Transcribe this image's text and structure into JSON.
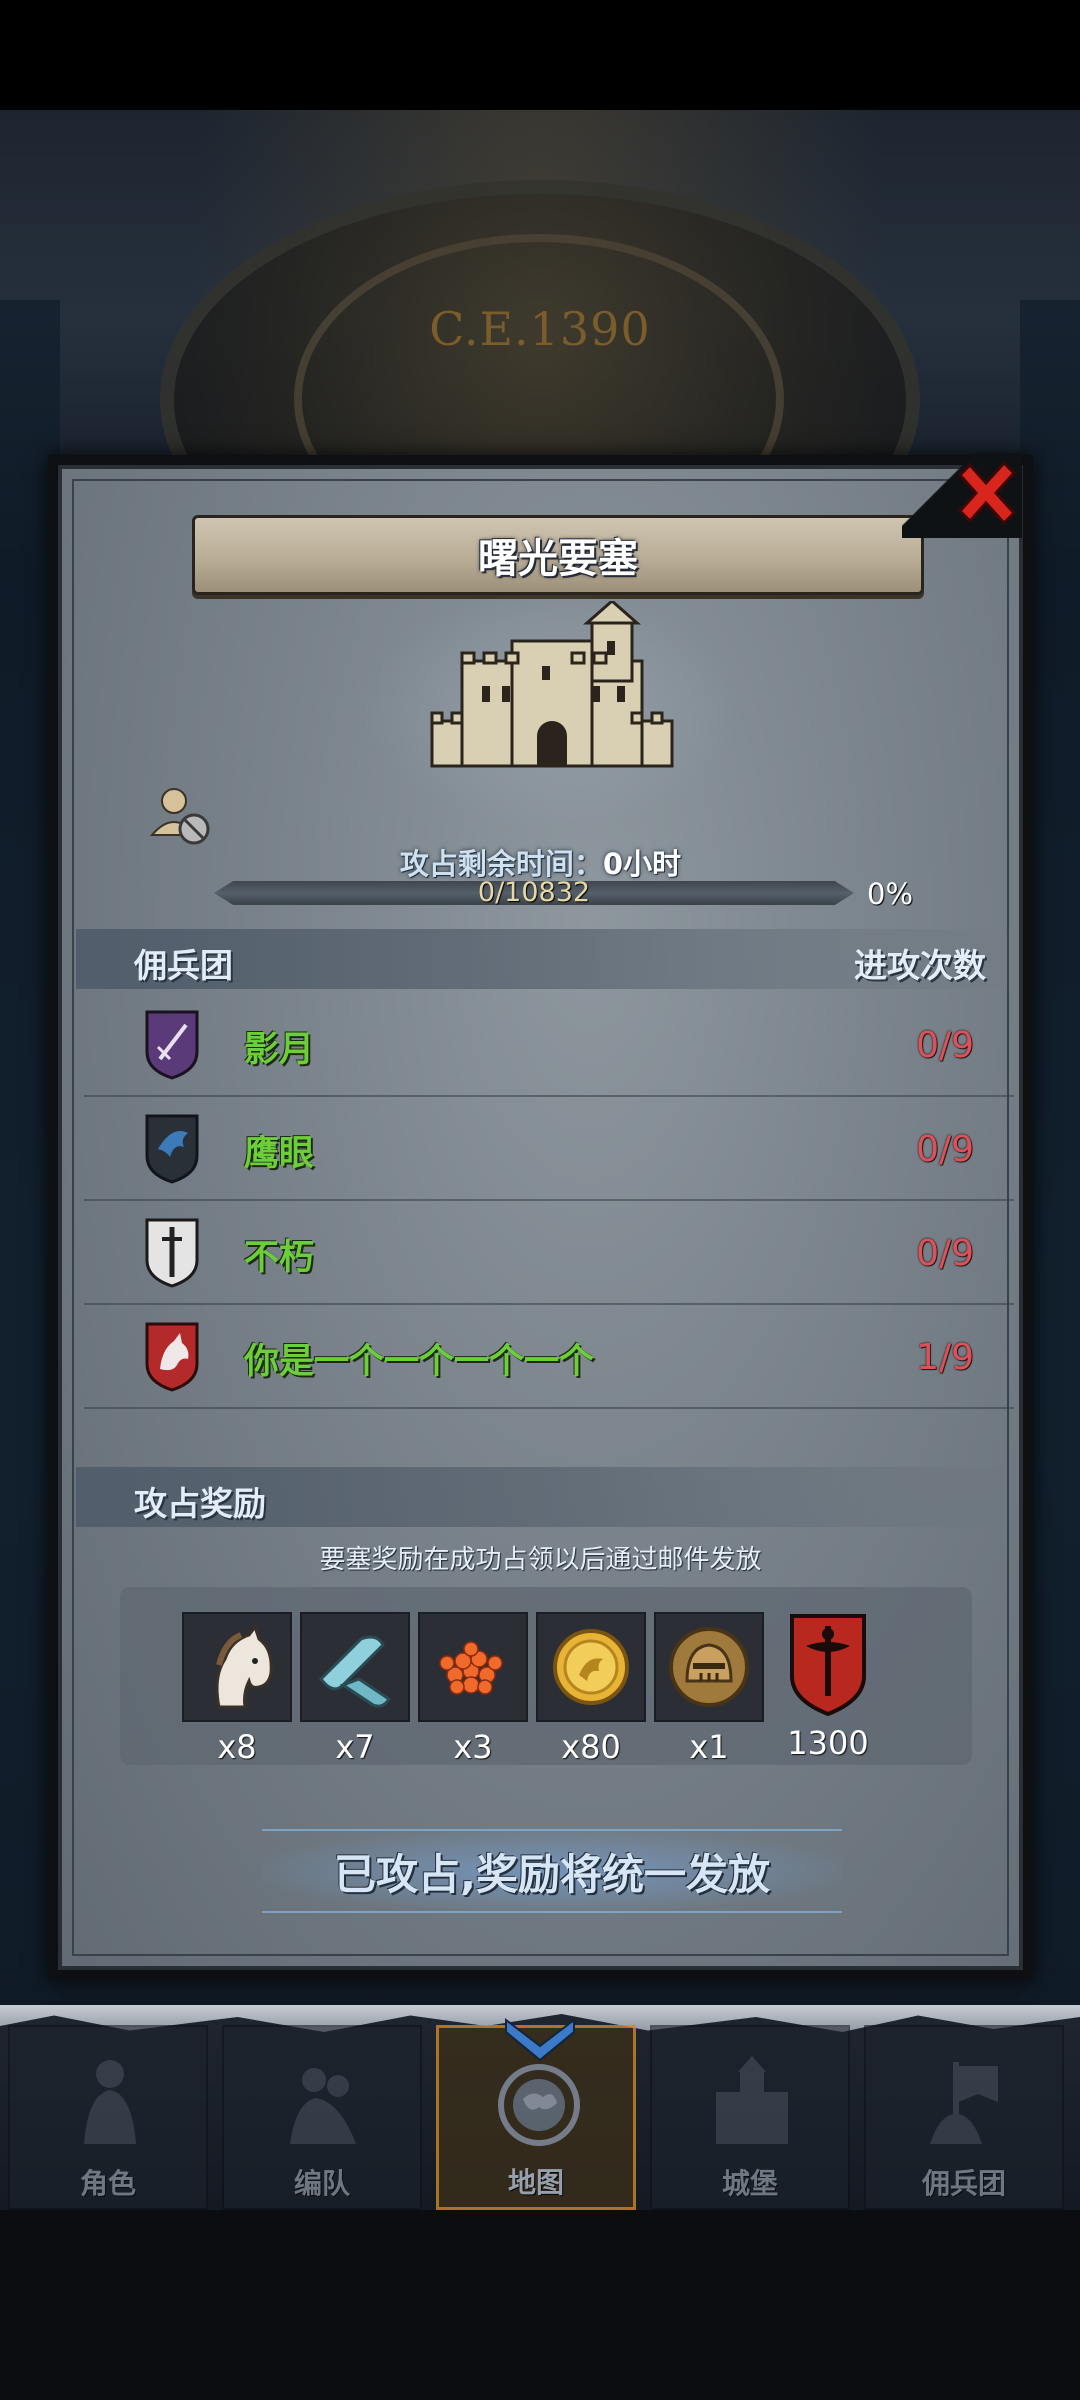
{
  "background": {
    "era": "C.E.1390"
  },
  "dialog": {
    "title": "曙光要塞",
    "close_icon": "close-x-icon",
    "capture": {
      "remaining_label": "攻占剩余时间：",
      "remaining_value": "0小时",
      "progress_text": "0/10832",
      "progress_percent": "0%",
      "progress_fraction": 0
    },
    "guild_section": {
      "title": "佣兵团",
      "attacks_header": "进攻次数",
      "rows": [
        {
          "name": "影月",
          "count": "0/9",
          "emblem": "purple-sword-shield-icon",
          "color": "#5a3a78"
        },
        {
          "name": "鹰眼",
          "count": "0/9",
          "emblem": "blue-eagle-shield-icon",
          "color": "#2c4a66"
        },
        {
          "name": "不朽",
          "count": "0/9",
          "emblem": "white-sword-shield-icon",
          "color": "#d8d8d8"
        },
        {
          "name": "你是一个一个一个一个",
          "count": "1/9",
          "emblem": "red-wolf-shield-icon",
          "color": "#b42a2a"
        }
      ]
    },
    "reward_section": {
      "title": "攻占奖励",
      "note": "要塞奖励在成功占领以后通过邮件发放",
      "items": [
        {
          "icon": "horse-head-icon",
          "qty": "x8"
        },
        {
          "icon": "cloth-roll-icon",
          "qty": "x7"
        },
        {
          "icon": "red-caviar-icon",
          "qty": "x3"
        },
        {
          "icon": "gold-coin-icon",
          "qty": "x80"
        },
        {
          "icon": "knight-helmet-icon",
          "qty": "x1"
        },
        {
          "icon": "red-banner-emblem-icon",
          "qty": "1300"
        }
      ]
    },
    "status": "已攻占,奖励将统一发放"
  },
  "nav": {
    "items": [
      {
        "label": "角色",
        "icon": "knight-figure-icon"
      },
      {
        "label": "编队",
        "icon": "troop-formation-icon"
      },
      {
        "label": "地图",
        "icon": "world-map-compass-icon",
        "active": true
      },
      {
        "label": "城堡",
        "icon": "castle-icon"
      },
      {
        "label": "佣兵团",
        "icon": "guild-banner-icon"
      }
    ]
  },
  "colors": {
    "guild_name": "#6ccf3a",
    "attack_count": "#e05058",
    "progress_gold": "#d7b246",
    "active_tab_border": "#d08a24"
  }
}
